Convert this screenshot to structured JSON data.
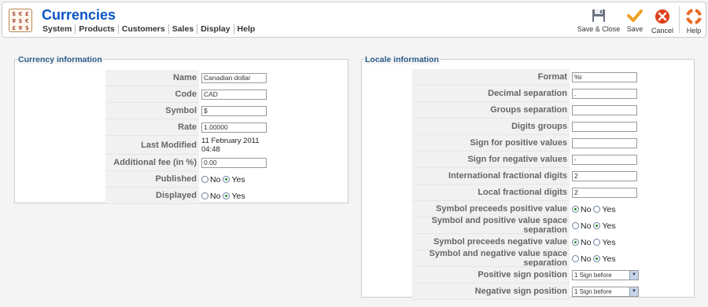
{
  "header": {
    "title": "Currencies",
    "menu": [
      "System",
      "Products",
      "Customers",
      "Sales",
      "Display",
      "Help"
    ],
    "logo_letters": [
      "$",
      "€",
      "£",
      "¥",
      "$",
      "€",
      "£",
      "¥",
      "$"
    ]
  },
  "toolbar": {
    "save_close": "Save & Close",
    "save": "Save",
    "cancel": "Cancel",
    "help": "Help"
  },
  "colors": {
    "title": "#0b55c4",
    "legend": "#2a5a8a",
    "save_check": "#f0a020",
    "cancel": "#e0401a"
  },
  "currency": {
    "legend": "Currency information",
    "name_label": "Name",
    "name_value": "Canadian dollar",
    "code_label": "Code",
    "code_value": "CAD",
    "symbol_label": "Symbol",
    "symbol_value": "$",
    "rate_label": "Rate",
    "rate_value": "1.00000",
    "modified_label": "Last Modified",
    "modified_value": "11 February 2011 04:48",
    "fee_label": "Additional fee (in %)",
    "fee_value": "0.00",
    "published_label": "Published",
    "published_no": "No",
    "published_yes": "Yes",
    "published_selected": "Yes",
    "displayed_label": "Displayed",
    "displayed_no": "No",
    "displayed_yes": "Yes",
    "displayed_selected": "Yes"
  },
  "locale": {
    "legend": "Locale information",
    "format_label": "Format",
    "format_value": "%i",
    "decimal_label": "Decimal separation",
    "decimal_value": ".",
    "groups_label": "Groups separation",
    "groups_value": "",
    "digits_label": "Digits groups",
    "digits_value": "",
    "pos_sign_label": "Sign for positive values",
    "pos_sign_value": "",
    "neg_sign_label": "Sign for negative values",
    "neg_sign_value": "-",
    "intl_frac_label": "International fractional digits",
    "intl_frac_value": "2",
    "local_frac_label": "Local fractional digits",
    "local_frac_value": "2",
    "sym_pre_pos_label": "Symbol preceeds positive value",
    "sym_pre_pos_selected": "No",
    "sym_space_pos_label": "Symbol and positive value space separation",
    "sym_space_pos_selected": "Yes",
    "sym_pre_neg_label": "Symbol preceeds negative value",
    "sym_pre_neg_selected": "No",
    "sym_space_neg_label": "Symbol and negative value space separation",
    "sym_space_neg_selected": "Yes",
    "no": "No",
    "yes": "Yes",
    "pos_pos_label": "Positive sign position",
    "pos_pos_value": "1 Sign before",
    "neg_pos_label": "Negative sign position",
    "neg_pos_value": "1 Sign before"
  }
}
